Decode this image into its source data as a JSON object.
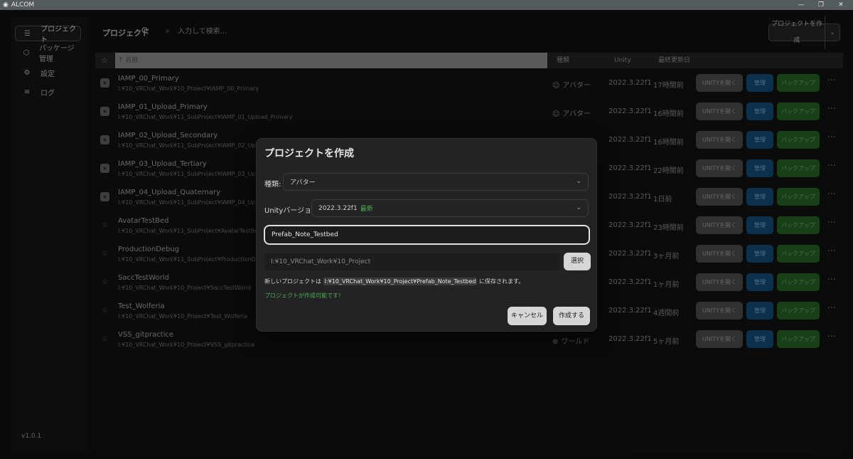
{
  "window": {
    "title": "ALCOM",
    "controls": [
      "—",
      "❐",
      "✕"
    ]
  },
  "sidebar": {
    "items": [
      {
        "icon": "list-icon",
        "glyph": "☰",
        "label": "プロジェクト",
        "active": true
      },
      {
        "icon": "package-icon",
        "glyph": "⬡",
        "label": "パッケージ管理",
        "active": false
      },
      {
        "icon": "gear-icon",
        "glyph": "⚙",
        "label": "設定",
        "active": false
      },
      {
        "icon": "log-icon",
        "glyph": "≡",
        "label": "ログ",
        "active": false
      }
    ],
    "version": "v1.0.1"
  },
  "header": {
    "title": "プロジェクト",
    "search_placeholder": "入力して検索...",
    "create_button": "プロジェクトを作成"
  },
  "table": {
    "columns": {
      "name": "↑ 名前",
      "type": "種類",
      "unity": "Unity",
      "updated": "最終更新日"
    },
    "button_labels": {
      "open": "UNITYを開く",
      "manage": "管理",
      "backup": "バックアップ"
    },
    "rows": [
      {
        "name": "IAMP_00_Primary",
        "path": "I:¥10_VRChat_Work¥10_Project¥IAMP_00_Primary",
        "type": "アバター",
        "unity": "2022.3.22f1",
        "updated": "17時間前",
        "favorite": true
      },
      {
        "name": "IAMP_01_Upload_Primary",
        "path": "I:¥10_VRChat_Work¥11_SubProject¥IAMP_01_Upload_Primary",
        "type": "アバター",
        "unity": "2022.3.22f1",
        "updated": "16時間前",
        "favorite": true
      },
      {
        "name": "IAMP_02_Upload_Secondary",
        "path": "I:¥10_VRChat_Work¥11_SubProject¥IAMP_02_Uplo",
        "type": "",
        "unity": "2022.3.22f1",
        "updated": "16時間前",
        "favorite": true
      },
      {
        "name": "IAMP_03_Upload_Tertiary",
        "path": "I:¥10_VRChat_Work¥11_SubProject¥IAMP_03_Uplo",
        "type": "",
        "unity": "2022.3.22f1",
        "updated": "22時間前",
        "favorite": true
      },
      {
        "name": "IAMP_04_Upload_Quaternary",
        "path": "I:¥10_VRChat_Work¥11_SubProject¥IAMP_04_Uplo",
        "type": "",
        "unity": "2022.3.22f1",
        "updated": "1日前",
        "favorite": true
      },
      {
        "name": "AvatarTestBed",
        "path": "I:¥10_VRChat_Work¥11_SubProject¥AvatarTestBed",
        "type": "",
        "unity": "2022.3.22f1",
        "updated": "23時間前",
        "favorite": false
      },
      {
        "name": "ProductionDebug",
        "path": "I:¥10_VRChat_Work¥11_SubProject¥ProductionDe",
        "type": "",
        "unity": "2022.3.22f1",
        "updated": "3ヶ月前",
        "favorite": false
      },
      {
        "name": "SaccTestWorld",
        "path": "I:¥10_VRChat_Work¥10_Project¥SaccTestWorld",
        "type": "",
        "unity": "2022.3.22f1",
        "updated": "1ヶ月前",
        "favorite": false
      },
      {
        "name": "Test_Wolferia",
        "path": "I:¥10_VRChat_Work¥10_Project¥Test_Wolferia",
        "type": "",
        "unity": "2022.3.22f1",
        "updated": "4週間前",
        "favorite": false
      },
      {
        "name": "VSS_gitpractice",
        "path": "I:¥10_VRChat_Work¥10_Project¥VSS_gitpractice",
        "type": "ワールド",
        "unity": "2022.3.22f1",
        "updated": "5ヶ月前",
        "favorite": false
      }
    ]
  },
  "modal": {
    "title": "プロジェクトを作成",
    "type_label": "種類:",
    "type_value": "アバター",
    "unity_label": "Unityバージョン:",
    "unity_value": "2022.3.22f1",
    "unity_latest": "最新",
    "project_name": "Prefab_Note_Testbed",
    "location": "I:¥10_VRChat_Work¥10_Project",
    "select_button": "選択",
    "save_prefix": "新しいプロジェクトは",
    "save_path": "I:¥10_VRChat_Work¥10_Project¥Prefab_Note_Testbed",
    "save_suffix": "に保存されます。",
    "status_ok": "プロジェクトが作成可能です！",
    "cancel_button": "キャンセル",
    "create_button": "作成する"
  },
  "colors": {
    "accent_green": "#4caf50",
    "manage_blue": "#0f3a5c",
    "backup_green": "#1e4a1e"
  }
}
